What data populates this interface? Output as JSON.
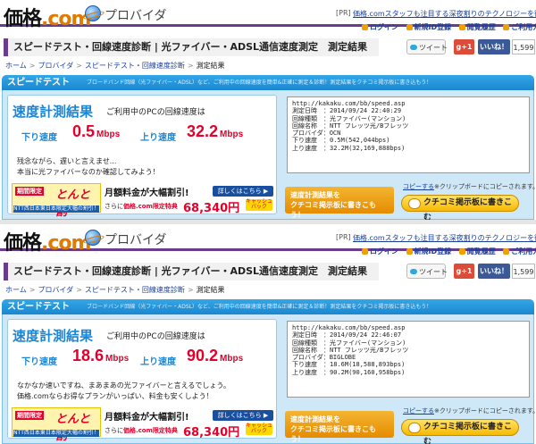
{
  "header": {
    "logo_text": "価格",
    "logo_dot": ".com",
    "provider_label": "プロバイダ",
    "pr_label": "[PR]",
    "catchphrase": "価格.comスタッフも注目する深夜割りのテクノロジーを徹底検証",
    "links": [
      "ログイン",
      "新規ID登録",
      "閲覧履歴",
      "ご利用ガイド"
    ]
  },
  "page_title": "スピードテスト・回線速度診断 | 光ファイバー・ADSL通信速度測定　測定結果",
  "social": {
    "tweet": "ツイート",
    "gplus": "g+1",
    "like": "いいね！",
    "count": "1,599"
  },
  "breadcrumb": [
    "ホーム",
    "プロバイダ",
    "スピードテスト・回線速度診断",
    "測定結果"
  ],
  "speedtest": {
    "title": "スピードテスト",
    "desc": "ブロードバンド回線（光ファイバー・ADSL）など、ご利用中の回線速度を簡単&正確に測定＆診断！測定結果をクチコミ掲示板に書き込もう！",
    "result_title": "速度計測結果",
    "result_sub": "ご利用中のPCの回線速度は",
    "down_label": "下り速度",
    "up_label": "上り速度",
    "unit": "Mbps",
    "copy_link": "コピーする",
    "copy_text": "※クリップボードにコピーされます。",
    "invite": "速度計測結果を\nクチコミ掲示板に書きこもう！",
    "kuchikomi_button": "クチコミ掲示板に書きこむ"
  },
  "ad": {
    "tag": "期間限定",
    "big": "とんと割",
    "footer": "NTT西日本東日本限定大幅の割引！",
    "main": "月額料金が大幅割引!",
    "more": "詳しくはこちら ▶",
    "cheap_prefix": "さらに",
    "cheap_bold": "価格.com限定特典",
    "price": "68,340円",
    "cashback": "キャッシュバック"
  },
  "results": [
    {
      "down": "0.5",
      "up": "32.2",
      "message": [
        "残念ながら、遅いと言えませ... ",
        "本当に光ファイバーなのか確認してみよう！"
      ],
      "textbox": "http://kakaku.com/bb/speed.asp\n測定日時　：2014/09/24 22:40:29\n回線種類　：光ファイバー(マンション)\n回線名称　：NTT フレッツ光/Bフレッツ\nプロバイダ：OCN\n下り速度　：0.5M(542,044bps)\n上り速度　：32.2M(32,169,888bps)"
    },
    {
      "down": "18.6",
      "up": "90.2",
      "message": [
        "なかなか速いですね、まあまあの光ファイバーと言えるでしょう。",
        "価格.comならお得なプランがいっぱい、料金も安くしよう！"
      ],
      "textbox": "http://kakaku.com/bb/speed.asp\n測定日時　：2014/09/24 22:46:07\n回線種類　：光ファイバー(マンション)\n回線名称　：NTT フレッツ光/Bフレッツ\nプロバイダ：BIGLOBE\n下り速度　：18.6M(18,588,893bps)\n上り速度　：90.2M(90,160,958bps)"
    }
  ],
  "colors": {
    "accent": "#6a3c8f",
    "speed_red": "#e4002b",
    "label_blue": "#1a86d6",
    "header_blue": "#1b86cf"
  }
}
